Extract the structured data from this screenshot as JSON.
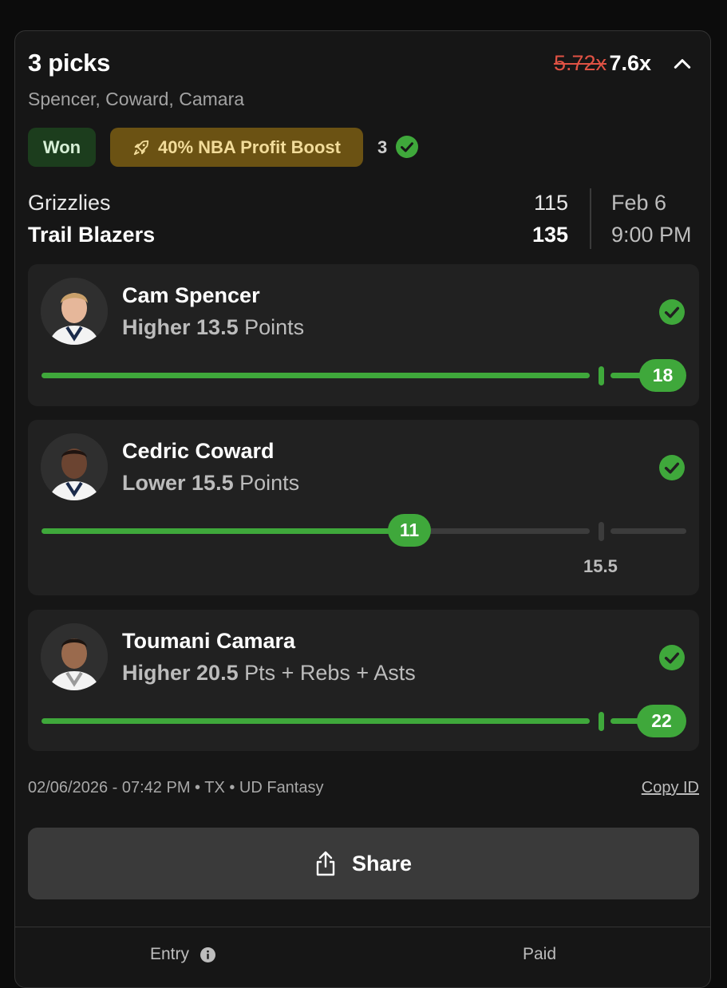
{
  "entry": {
    "title": "3 picks",
    "old_multiplier": "5.72x",
    "new_multiplier": "7.6x",
    "players_summary": "Spencer, Coward, Camara",
    "status_badge": "Won",
    "boost_label": "40% NBA Profit Boost",
    "correct_count": "3"
  },
  "game": {
    "team1": "Grizzlies",
    "team1_score": "115",
    "team2": "Trail Blazers",
    "team2_score": "135",
    "date": "Feb 6",
    "time": "9:00 PM"
  },
  "picks": [
    {
      "name": "Cam Spencer",
      "direction": "Higher",
      "line": "13.5",
      "stat": "Points",
      "result": "18",
      "progress_pct": 100
    },
    {
      "name": "Cedric Coward",
      "direction": "Lower",
      "line": "15.5",
      "stat": "Points",
      "result": "11",
      "progress_pct": 71
    },
    {
      "name": "Toumani Camara",
      "direction": "Higher",
      "line": "20.5",
      "stat": "Pts + Rebs + Asts",
      "result": "22",
      "progress_pct": 100
    }
  ],
  "footer": {
    "meta": "02/06/2026 - 07:42 PM • TX • UD Fantasy",
    "copy_id": "Copy ID",
    "share_label": "Share",
    "entry_label": "Entry",
    "paid_label": "Paid"
  },
  "icons": {
    "boost": "rocket-icon",
    "collapse": "chevron-up-icon",
    "result": "check-circle-icon",
    "share": "share-icon",
    "info": "info-icon"
  },
  "colors": {
    "won_green": "#3fa83b",
    "strike_red": "#e05244",
    "boost_gold": "#6b5213"
  }
}
